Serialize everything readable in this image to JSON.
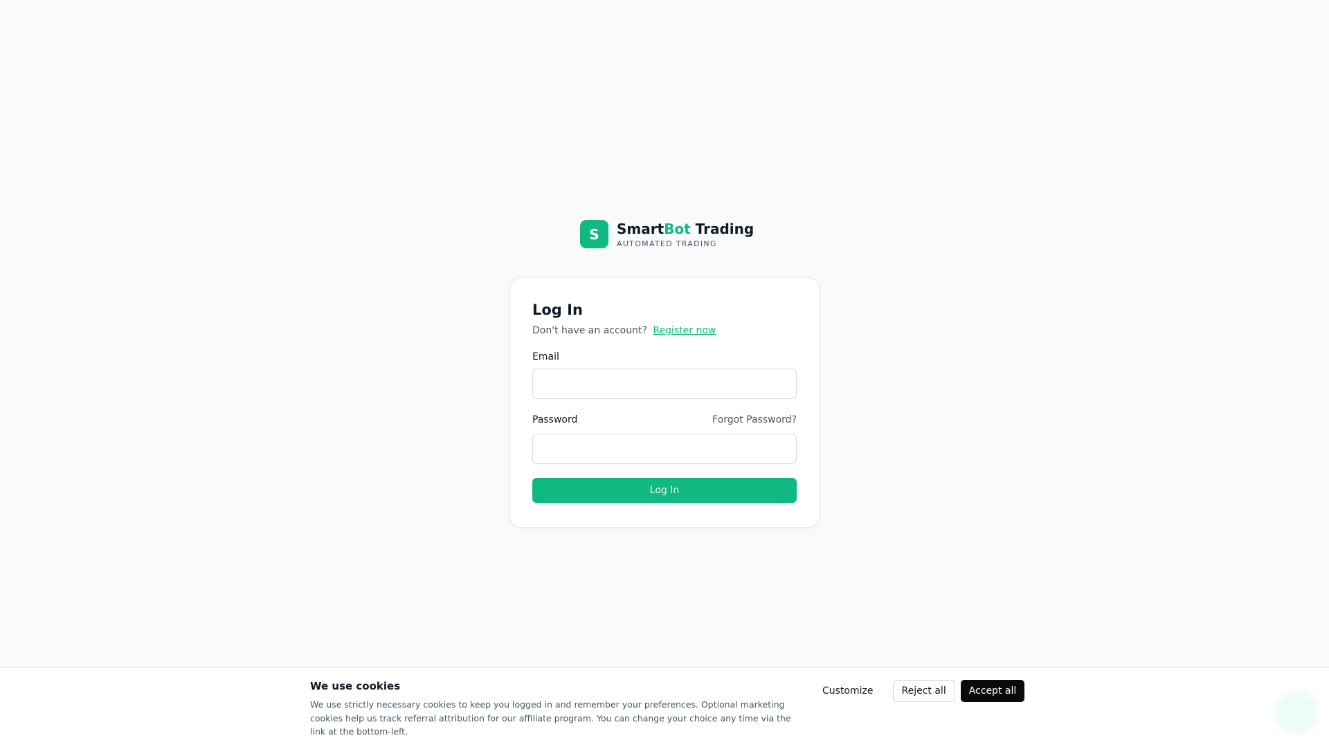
{
  "brand": {
    "logo_letter": "S",
    "name_part1": "Smart",
    "name_accent": "Bot",
    "name_part2": " Trading",
    "tagline": "AUTOMATED TRADING",
    "accent_color": "#10b981"
  },
  "login": {
    "title": "Log In",
    "no_account_text": "Don't have an account?",
    "register_link": "Register now",
    "email_label": "Email",
    "email_value": "",
    "password_label": "Password",
    "password_value": "",
    "forgot_link": "Forgot Password?",
    "submit_label": "Log In"
  },
  "cookie_banner": {
    "title": "We use cookies",
    "body": "We use strictly necessary cookies to keep you logged in and remember your preferences. Optional marketing cookies help us track referral attribution for our affiliate program. You can change your choice any time via the link at the bottom-left.",
    "customize_label": "Customize",
    "reject_label": "Reject all",
    "accept_label": "Accept all"
  }
}
